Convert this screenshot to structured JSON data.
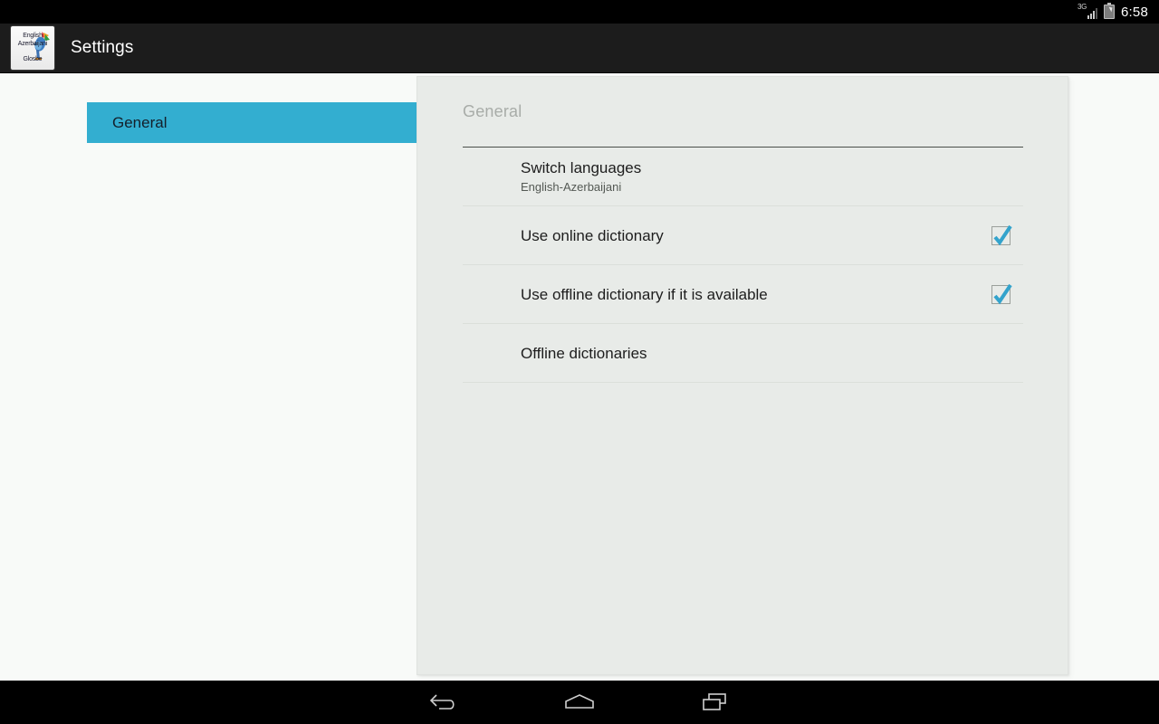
{
  "status_bar": {
    "network_label": "3G",
    "signal_icon": "signal-bars-icon",
    "battery_icon": "battery-charging-icon",
    "clock": "6:58"
  },
  "action_bar": {
    "title": "Settings",
    "app_icon": {
      "name": "glosbe-app-icon",
      "line1": "English",
      "line2": "Azerbaijani",
      "line3": "Glosbe"
    }
  },
  "sidebar": {
    "items": [
      {
        "label": "General",
        "selected": true
      }
    ]
  },
  "detail": {
    "category_title": "General",
    "rows": [
      {
        "title": "Switch languages",
        "summary": "English-Azerbaijani",
        "widget": "none",
        "checked": false
      },
      {
        "title": "Use online dictionary",
        "summary": "",
        "widget": "checkbox",
        "checked": true
      },
      {
        "title": "Use offline dictionary if it is available",
        "summary": "",
        "widget": "checkbox",
        "checked": true
      },
      {
        "title": "Offline dictionaries",
        "summary": "",
        "widget": "none",
        "checked": false
      }
    ]
  },
  "nav_bar": {
    "buttons": [
      {
        "name": "back-icon",
        "label": "Back"
      },
      {
        "name": "home-icon",
        "label": "Home"
      },
      {
        "name": "recents-icon",
        "label": "Recent apps"
      }
    ]
  },
  "colors": {
    "accent": "#33aed0",
    "panel_bg": "#e8ebe8",
    "page_bg": "#f8faf8",
    "action_bar_bg": "#1c1c1c",
    "checkbox_check": "#33a3cc"
  }
}
